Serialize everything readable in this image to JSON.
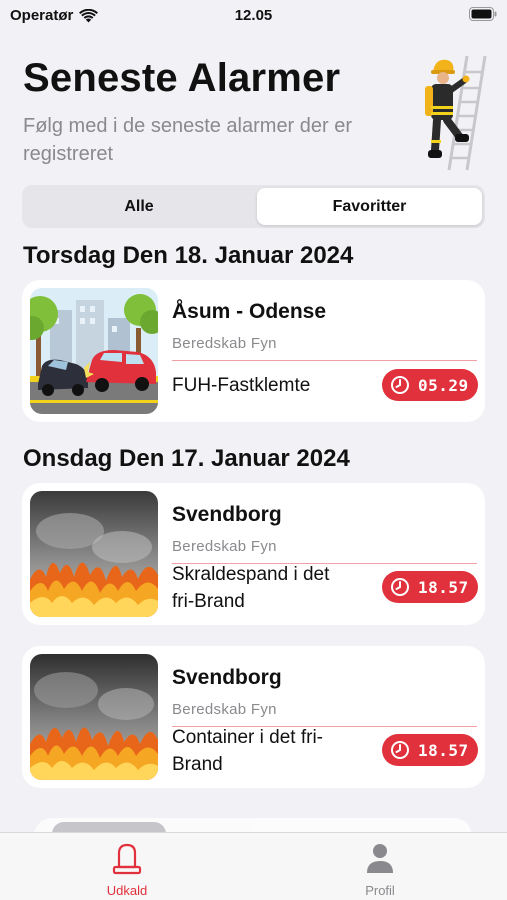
{
  "status_bar": {
    "carrier": "Operatør",
    "time": "12.05"
  },
  "header": {
    "title": "Seneste Alarmer",
    "subtitle": "Følg med i de seneste alarmer der er registreret"
  },
  "filter": {
    "segments": [
      "Alle",
      "Favoritter"
    ],
    "selected": "Favoritter"
  },
  "sections": [
    {
      "date": "Torsdag Den 18. Januar 2024",
      "alarms": [
        {
          "location": "Åsum - Odense",
          "service": "Beredskab Fyn",
          "type": "FUH-Fastklemte",
          "time": "05.29",
          "image": "car-crash-illustration"
        }
      ]
    },
    {
      "date": "Onsdag Den 17. Januar 2024",
      "alarms": [
        {
          "location": "Svendborg",
          "service": "Beredskab Fyn",
          "type": "Skraldespand i det fri-Brand",
          "time": "18.57",
          "image": "fire-illustration"
        },
        {
          "location": "Svendborg",
          "service": "Beredskab Fyn",
          "type": "Container i det fri-Brand",
          "time": "18.57",
          "image": "fire-illustration"
        }
      ]
    }
  ],
  "tab_bar": {
    "tabs": [
      {
        "label": "Udkald",
        "icon": "siren-icon",
        "active": true
      },
      {
        "label": "Profil",
        "icon": "person-icon",
        "active": false
      }
    ]
  },
  "colors": {
    "accent": "#e0313c",
    "background": "#f2f2f6",
    "secondary_text": "#8a8a8e",
    "card": "#ffffff"
  }
}
